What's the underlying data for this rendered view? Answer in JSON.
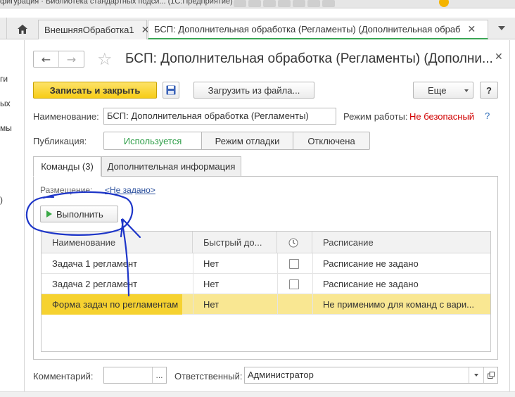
{
  "window": {
    "title_text": "фигурация · Библиотека стандартных подси... (1С:Предприятие)"
  },
  "tabs": [
    {
      "label": "ВнешняяОбработка1"
    },
    {
      "label": "БСП: Дополнительная обработка (Регламенты) (Дополнительная обраб"
    }
  ],
  "sidebar_fragments": [
    "ги",
    "ых",
    "мы",
    ")"
  ],
  "form": {
    "title": "БСП: Дополнительная обработка (Регламенты) (Дополни...",
    "toolbar": {
      "save_close_label": "Записать и закрыть",
      "load_label": "Загрузить из файла...",
      "more_label": "Еще",
      "help_label": "?"
    },
    "name_label": "Наименование:",
    "name_value": "БСП: Дополнительная обработка (Регламенты)",
    "mode_label": "Режим работы:",
    "mode_value": "Не безопасный",
    "mode_help": "?",
    "publication_label": "Публикация:",
    "publication_options": [
      "Используется",
      "Режим отладки",
      "Отключена"
    ],
    "publication_selected": "Используется",
    "content_tabs": [
      "Команды (3)",
      "Дополнительная информация"
    ],
    "placement_label": "Размещение:",
    "placement_link": "<Не задано>",
    "run_label": "Выполнить",
    "table": {
      "columns": [
        "Наименование",
        "Быстрый до...",
        "",
        "Расписание"
      ],
      "rows": [
        {
          "name": "Задача 1 регламент",
          "quick": "Нет",
          "checked": false,
          "schedule": "Расписание не задано"
        },
        {
          "name": "Задача 2 регламент",
          "quick": "Нет",
          "checked": false,
          "schedule": "Расписание не задано"
        },
        {
          "name": "Форма задач по регламентам",
          "quick": "Нет",
          "checked": null,
          "schedule": "Не применимо для команд с вари..."
        }
      ],
      "selected_row": 2
    },
    "comment_label": "Комментарий:",
    "comment_value": "",
    "comment_button": "...",
    "responsible_label": "Ответственный:",
    "responsible_value": "Администратор"
  },
  "colors": {
    "accent_green": "#3aa655",
    "primary_yellow": "#f7cd16",
    "selected_row": "#f9e792",
    "mode_red": "#d10000",
    "link_blue": "#2a4f9c",
    "annotation_blue": "#1d35c8"
  }
}
